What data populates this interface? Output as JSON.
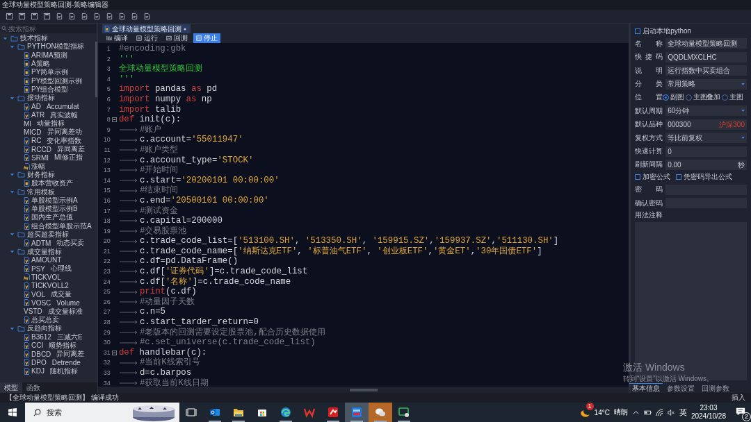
{
  "window": {
    "title": "全球动量模型策略回测-策略编辑器"
  },
  "sidebar": {
    "search": {
      "placeholder": "搜索指标"
    },
    "tree": [
      {
        "label": "技术指标",
        "kind": "folder",
        "expanded": true,
        "children": [
          {
            "label": "PYTHON模型指标",
            "kind": "folder",
            "expanded": true,
            "children": [
              {
                "label": "ARIMA预测",
                "kind": "py"
              },
              {
                "label": "A策略",
                "kind": "py"
              },
              {
                "label": "PY简单示例",
                "kind": "py"
              },
              {
                "label": "PY模型回测示例",
                "kind": "py"
              },
              {
                "label": "PY组合模型",
                "kind": "py"
              }
            ]
          },
          {
            "label": "摆动指标",
            "kind": "folder",
            "expanded": true,
            "children": [
              {
                "label": "AD",
                "note": "Accumulat",
                "kind": "v"
              },
              {
                "label": "ATR",
                "note": "真实波幅",
                "kind": "v"
              },
              {
                "label": "MI",
                "note": "动量指标",
                "kind": "plain"
              },
              {
                "label": "MICD",
                "note": "异同离差动",
                "kind": "plain"
              },
              {
                "label": "RC",
                "note": "变化率指数",
                "kind": "v"
              },
              {
                "label": "RCCD",
                "note": "异同离差",
                "kind": "v"
              },
              {
                "label": "SRMI",
                "note": "MI修正指",
                "kind": "v"
              },
              {
                "label": "涨幅",
                "kind": "av"
              }
            ]
          },
          {
            "label": "财务指标",
            "kind": "folder",
            "expanded": true,
            "children": [
              {
                "label": "股本营收资产",
                "kind": "py"
              }
            ]
          },
          {
            "label": "常用模板",
            "kind": "folder",
            "expanded": true,
            "children": [
              {
                "label": "单股模型示例A",
                "kind": "v"
              },
              {
                "label": "单股模型示例B",
                "kind": "v"
              },
              {
                "label": "国内生产总值",
                "kind": "v"
              },
              {
                "label": "组合模型单股示范A",
                "kind": "v"
              }
            ]
          },
          {
            "label": "超买超卖指标",
            "kind": "folder",
            "expanded": true,
            "children": [
              {
                "label": "ADTM",
                "note": "动态买卖",
                "kind": "v"
              }
            ]
          },
          {
            "label": "成交量指标",
            "kind": "folder",
            "expanded": true,
            "children": [
              {
                "label": "AMOUNT",
                "kind": "v"
              },
              {
                "label": "PSY",
                "note": "心理线",
                "kind": "v"
              },
              {
                "label": "TICKVOL",
                "kind": "av"
              },
              {
                "label": "TICKVOLL2",
                "kind": "v"
              },
              {
                "label": "VOL",
                "note": "成交量",
                "kind": "v"
              },
              {
                "label": "VOSC",
                "note": "Volume",
                "kind": "v"
              },
              {
                "label": "VSTD",
                "note": "成交量标准",
                "kind": "plain"
              },
              {
                "label": "总买总卖",
                "kind": "v"
              }
            ]
          },
          {
            "label": "反趋向指标",
            "kind": "folder",
            "expanded": true,
            "children": [
              {
                "label": "B3612",
                "note": "三减六E",
                "kind": "v"
              },
              {
                "label": "CCI",
                "note": "顺势指标",
                "kind": "v"
              },
              {
                "label": "DBCD",
                "note": "异同离差",
                "kind": "v"
              },
              {
                "label": "DPO",
                "note": "Detrende",
                "kind": "v"
              },
              {
                "label": "KDJ",
                "note": "随机指标",
                "kind": "v"
              }
            ]
          }
        ]
      }
    ],
    "tabs": [
      {
        "label": "模型",
        "selected": true
      },
      {
        "label": "函数",
        "selected": false
      }
    ]
  },
  "editor": {
    "tab": {
      "label": "全球动量模型策略回测"
    },
    "actions": [
      {
        "label": "编译",
        "kind": "compile",
        "selected": false
      },
      {
        "label": "运行",
        "kind": "run",
        "selected": false
      },
      {
        "label": "回测",
        "kind": "backtest",
        "selected": false
      },
      {
        "label": "停止",
        "kind": "stop",
        "selected": true
      }
    ],
    "lines": [
      {
        "number": "1",
        "indented": false,
        "fold": false,
        "tokens": [
          {
            "kind": "comment",
            "text": "#encoding:gbk"
          }
        ]
      },
      {
        "number": "2",
        "indented": false,
        "fold": false,
        "tokens": [
          {
            "kind": "doc",
            "text": "'''"
          }
        ]
      },
      {
        "number": "3",
        "indented": false,
        "fold": false,
        "tokens": [
          {
            "kind": "doc",
            "text": "全球动量模型策略回测"
          }
        ]
      },
      {
        "number": "4",
        "indented": false,
        "fold": false,
        "tokens": [
          {
            "kind": "doc",
            "text": "'''"
          }
        ]
      },
      {
        "number": "5",
        "indented": false,
        "fold": false,
        "tokens": [
          {
            "kind": "keyword",
            "text": "import"
          },
          {
            "kind": "plain",
            "text": " pandas "
          },
          {
            "kind": "keyword",
            "text": "as"
          },
          {
            "kind": "plain",
            "text": " pd"
          }
        ]
      },
      {
        "number": "6",
        "indented": false,
        "fold": false,
        "tokens": [
          {
            "kind": "keyword",
            "text": "import"
          },
          {
            "kind": "plain",
            "text": " numpy "
          },
          {
            "kind": "keyword",
            "text": "as"
          },
          {
            "kind": "plain",
            "text": " np"
          }
        ]
      },
      {
        "number": "7",
        "indented": false,
        "fold": false,
        "tokens": [
          {
            "kind": "keyword",
            "text": "import"
          },
          {
            "kind": "plain",
            "text": " talib"
          }
        ]
      },
      {
        "number": "8",
        "indented": false,
        "fold": true,
        "tokens": [
          {
            "kind": "keyword",
            "text": "def"
          },
          {
            "kind": "plain",
            "text": " init(c):"
          }
        ]
      },
      {
        "number": "9",
        "indented": true,
        "fold": false,
        "tokens": [
          {
            "kind": "comment",
            "text": "#账户"
          }
        ]
      },
      {
        "number": "10",
        "indented": true,
        "fold": false,
        "tokens": [
          {
            "kind": "plain",
            "text": "c.account="
          },
          {
            "kind": "string",
            "text": "'55011947'"
          }
        ]
      },
      {
        "number": "11",
        "indented": true,
        "fold": false,
        "tokens": [
          {
            "kind": "comment",
            "text": "#账户类型"
          }
        ]
      },
      {
        "number": "12",
        "indented": true,
        "fold": false,
        "tokens": [
          {
            "kind": "plain",
            "text": "c.account_type="
          },
          {
            "kind": "string",
            "text": "'STOCK'"
          }
        ]
      },
      {
        "number": "13",
        "indented": true,
        "fold": false,
        "tokens": [
          {
            "kind": "comment",
            "text": "#开始时间"
          }
        ]
      },
      {
        "number": "14",
        "indented": true,
        "fold": false,
        "tokens": [
          {
            "kind": "plain",
            "text": "c.start="
          },
          {
            "kind": "string",
            "text": "'20200101 00:00:00'"
          }
        ]
      },
      {
        "number": "15",
        "indented": true,
        "fold": false,
        "tokens": [
          {
            "kind": "comment",
            "text": "#结束时间"
          }
        ]
      },
      {
        "number": "16",
        "indented": true,
        "fold": false,
        "tokens": [
          {
            "kind": "plain",
            "text": "c.end="
          },
          {
            "kind": "string",
            "text": "'20500101 00:00:00'"
          }
        ]
      },
      {
        "number": "17",
        "indented": true,
        "fold": false,
        "tokens": [
          {
            "kind": "comment",
            "text": "#测试资金"
          }
        ]
      },
      {
        "number": "18",
        "indented": true,
        "fold": false,
        "tokens": [
          {
            "kind": "plain",
            "text": "c.capital=200000"
          }
        ]
      },
      {
        "number": "19",
        "indented": true,
        "fold": false,
        "tokens": [
          {
            "kind": "comment",
            "text": "#交易股票池"
          }
        ]
      },
      {
        "number": "20",
        "indented": true,
        "fold": false,
        "tokens": [
          {
            "kind": "plain",
            "text": "c.trade_code_list=["
          },
          {
            "kind": "string",
            "text": "'513100.SH'"
          },
          {
            "kind": "plain",
            "text": ", "
          },
          {
            "kind": "string",
            "text": "'513350.SH'"
          },
          {
            "kind": "plain",
            "text": ", "
          },
          {
            "kind": "string",
            "text": "'159915.SZ'"
          },
          {
            "kind": "plain",
            "text": ","
          },
          {
            "kind": "string",
            "text": "'159937.SZ'"
          },
          {
            "kind": "plain",
            "text": ","
          },
          {
            "kind": "string",
            "text": "'511130.SH'"
          },
          {
            "kind": "plain",
            "text": "]"
          }
        ]
      },
      {
        "number": "21",
        "indented": true,
        "fold": false,
        "tokens": [
          {
            "kind": "plain",
            "text": "c.trade_code_name=["
          },
          {
            "kind": "string",
            "text": "'纳斯达克ETF'"
          },
          {
            "kind": "plain",
            "text": ", "
          },
          {
            "kind": "string",
            "text": "'标普油气ETF'"
          },
          {
            "kind": "plain",
            "text": ", "
          },
          {
            "kind": "string",
            "text": "'创业板ETF'"
          },
          {
            "kind": "plain",
            "text": ","
          },
          {
            "kind": "string",
            "text": "'黄金ET'"
          },
          {
            "kind": "plain",
            "text": ","
          },
          {
            "kind": "string",
            "text": "'30年国债ETF'"
          },
          {
            "kind": "plain",
            "text": "]"
          }
        ]
      },
      {
        "number": "22",
        "indented": true,
        "fold": false,
        "tokens": [
          {
            "kind": "plain",
            "text": "c.df=pd.DataFrame()"
          }
        ]
      },
      {
        "number": "23",
        "indented": true,
        "fold": false,
        "tokens": [
          {
            "kind": "plain",
            "text": "c.df["
          },
          {
            "kind": "string",
            "text": "'证券代码'"
          },
          {
            "kind": "plain",
            "text": "]=c.trade_code_list"
          }
        ]
      },
      {
        "number": "24",
        "indented": true,
        "fold": false,
        "tokens": [
          {
            "kind": "plain",
            "text": "c.df["
          },
          {
            "kind": "string",
            "text": "'名称'"
          },
          {
            "kind": "plain",
            "text": "]=c.trade_code_name"
          }
        ]
      },
      {
        "number": "25",
        "indented": true,
        "fold": false,
        "tokens": [
          {
            "kind": "keyword",
            "text": "print"
          },
          {
            "kind": "plain",
            "text": "(c.df)"
          }
        ]
      },
      {
        "number": "26",
        "indented": true,
        "fold": false,
        "tokens": [
          {
            "kind": "comment",
            "text": "#动量因子天数"
          }
        ]
      },
      {
        "number": "27",
        "indented": true,
        "fold": false,
        "tokens": [
          {
            "kind": "plain",
            "text": "c.n=5"
          }
        ]
      },
      {
        "number": "28",
        "indented": true,
        "fold": false,
        "tokens": [
          {
            "kind": "plain",
            "text": "c.start_tarder_return=0"
          }
        ]
      },
      {
        "number": "29",
        "indented": true,
        "fold": false,
        "tokens": [
          {
            "kind": "comment",
            "text": "#老版本的回测需要设定股票池,配合历史数据使用"
          }
        ]
      },
      {
        "number": "30",
        "indented": true,
        "fold": false,
        "tokens": [
          {
            "kind": "comment",
            "text": "#c.set_universe(c.trade_code_list)"
          }
        ]
      },
      {
        "number": "31",
        "indented": false,
        "fold": true,
        "tokens": [
          {
            "kind": "keyword",
            "text": "def"
          },
          {
            "kind": "plain",
            "text": " handlebar(c):"
          }
        ]
      },
      {
        "number": "32",
        "indented": true,
        "fold": false,
        "tokens": [
          {
            "kind": "comment",
            "text": "#当前K线索引号"
          }
        ]
      },
      {
        "number": "33",
        "indented": true,
        "fold": false,
        "tokens": [
          {
            "kind": "plain",
            "text": "d=c.barpos"
          }
        ]
      },
      {
        "number": "34",
        "indented": true,
        "fold": false,
        "tokens": [
          {
            "kind": "comment",
            "text": "#获取当前K线日期"
          }
        ]
      }
    ]
  },
  "properties": {
    "local_python": {
      "label": "启动本地python",
      "checked": false
    },
    "fields": [
      {
        "kind": "text",
        "label": "名称",
        "value": "全球动量模型策略回测"
      },
      {
        "kind": "text",
        "label": "快捷码",
        "value": "QQDLMXCLHC"
      },
      {
        "kind": "text",
        "label": "说明",
        "value": "运行指数中买卖组合"
      },
      {
        "kind": "select",
        "label": "分类",
        "value": "常用策略"
      },
      {
        "kind": "radio",
        "label": "位置",
        "options": [
          {
            "label": "副图",
            "selected": true
          },
          {
            "label": "主图叠加",
            "selected": false
          },
          {
            "label": "主图",
            "selected": false
          }
        ]
      },
      {
        "kind": "select",
        "label": "默认周期",
        "value": "60分钟"
      },
      {
        "kind": "code",
        "label": "默认品种",
        "value": "000300",
        "hint": "沪深300"
      },
      {
        "kind": "select",
        "label": "复权方式",
        "value": "等比前复权"
      },
      {
        "kind": "text",
        "label": "快速计算",
        "value": "0"
      },
      {
        "kind": "unit",
        "label": "刷新间隔",
        "value": "0.00",
        "unit": "秒"
      },
      {
        "kind": "checks",
        "options": [
          {
            "label": "加密公式",
            "checked": false
          },
          {
            "label": "凭密码导出公式",
            "checked": false
          }
        ]
      },
      {
        "kind": "text",
        "label": "密码"
      },
      {
        "kind": "text",
        "label": "确认密码"
      },
      {
        "kind": "area",
        "label": "用法注释"
      }
    ],
    "tabs": [
      {
        "label": "基本信息",
        "selected": true
      },
      {
        "label": "参数设置",
        "selected": false
      },
      {
        "label": "回测参数",
        "selected": false
      }
    ]
  },
  "status_bar": {
    "message": "【全球动量模型策略回测】 编译成功",
    "mode": "插入"
  },
  "activation": {
    "title": "激活 Windows",
    "hint": "转到“设置”以激活 Windows。"
  },
  "taskbar": {
    "search": {
      "placeholder": "搜索"
    },
    "apps": [
      {
        "kind": "taskview",
        "running": false,
        "selected": false,
        "attention": false
      },
      {
        "kind": "mail",
        "running": true,
        "selected": false,
        "attention": false
      },
      {
        "kind": "folder",
        "running": true,
        "selected": false,
        "attention": false
      },
      {
        "kind": "store",
        "running": false,
        "selected": false,
        "attention": false
      },
      {
        "kind": "browser",
        "running": true,
        "selected": false,
        "attention": false
      },
      {
        "kind": "office",
        "running": false,
        "selected": false,
        "attention": false
      },
      {
        "kind": "redapp",
        "running": true,
        "selected": false,
        "attention": false
      },
      {
        "kind": "blueapp",
        "running": true,
        "selected": true,
        "attention": false
      },
      {
        "kind": "chat",
        "running": true,
        "selected": false,
        "attention": true
      },
      {
        "kind": "greenapp",
        "running": true,
        "selected": false,
        "attention": false
      }
    ],
    "weather": {
      "badge": "1",
      "temperature": "14°C",
      "condition": "晴朗"
    },
    "language": "英",
    "time": "23:03",
    "date": "2024/10/28",
    "notifications": "2"
  }
}
